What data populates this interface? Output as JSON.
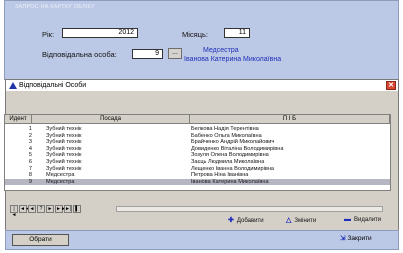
{
  "top_panel": {
    "title": "ЗАПРОС НА КАРТКУ ОБЛІКУ",
    "year_label": "Рік:",
    "year_value": "2012",
    "month_label": "Місяць:",
    "month_value": "11",
    "person_label": "Відповідальна особа:",
    "person_id": "9",
    "dots_label": "...",
    "person_position": "Медсестра",
    "person_name": "Іванова Катерина Миколаївна"
  },
  "dialog": {
    "title": "Відповідальні Особи",
    "close_label": "✕",
    "columns": [
      "Идент",
      "Посада",
      "П І Б"
    ],
    "rows": [
      {
        "id": "1",
        "position": "Зубний технік",
        "name": "Белкова Надія Терентівна"
      },
      {
        "id": "2",
        "position": "Зубний технік",
        "name": "Бабенко Ольга Миколаївна"
      },
      {
        "id": "3",
        "position": "Зубний технік",
        "name": "Брайченко Андрій Миколайович"
      },
      {
        "id": "4",
        "position": "Зубний технік",
        "name": "Довиденко Віталіна Володимирівна"
      },
      {
        "id": "5",
        "position": "Зубний технік",
        "name": "Зозуля Олена Володимирівна"
      },
      {
        "id": "6",
        "position": "Зубний технік",
        "name": "Заєць Людмила Миколаївна"
      },
      {
        "id": "7",
        "position": "Зубний технік",
        "name": "Лещенко Іванна Володимирівна"
      },
      {
        "id": "8",
        "position": "Медсестра",
        "name": "Петрова Ніна Іванівна"
      },
      {
        "id": "9",
        "position": "Медсестра",
        "name": "Іванова Катерина Миколаївна"
      }
    ],
    "selected_row_index": 8,
    "nav_buttons": [
      "|◄",
      "◄◄",
      "◄",
      "?",
      "►",
      "►►",
      "►|",
      "▌"
    ],
    "actions": {
      "add": "Добавити",
      "edit": "Змінити",
      "delete": "Видалити"
    }
  },
  "bottom_bar": {
    "choose_label": "Обрати",
    "close_label": "Закрити"
  }
}
